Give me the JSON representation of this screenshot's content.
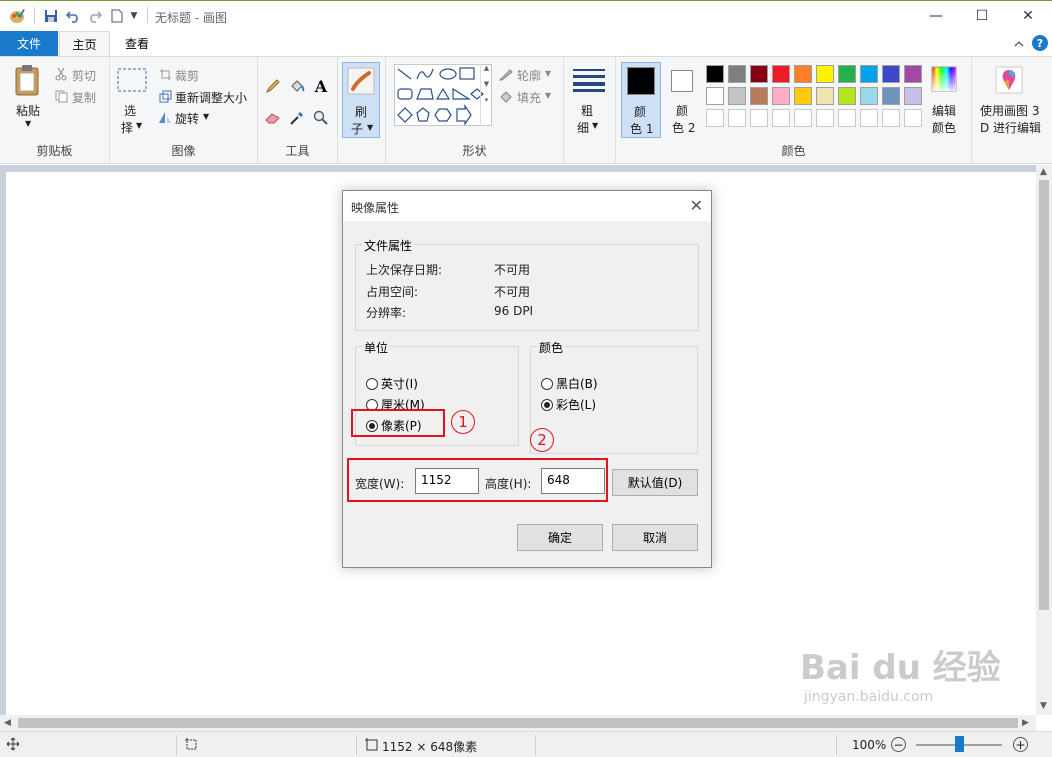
{
  "window": {
    "title": "无标题 - 画图",
    "minimize": "—",
    "maximize": "☐",
    "close": "✕"
  },
  "tabs": {
    "file": "文件",
    "home": "主页",
    "view": "查看"
  },
  "ribbon": {
    "clipboard": {
      "label": "剪贴板",
      "paste": "粘贴",
      "cut": "剪切",
      "copy": "复制"
    },
    "image": {
      "label": "图像",
      "select": "选",
      "select2": "择",
      "crop": "裁剪",
      "resize": "重新调整大小",
      "rotate": "旋转"
    },
    "tools": {
      "label": "工具",
      "text_tool": "A"
    },
    "brushes": {
      "label1": "刷",
      "label2": "子"
    },
    "shapes": {
      "label": "形状",
      "outline": "轮廓",
      "fill": "填充"
    },
    "size": {
      "label1": "粗",
      "label2": "细"
    },
    "colors": {
      "label": "颜色",
      "color1_a": "颜",
      "color1_b": "色 1",
      "color2_a": "颜",
      "color2_b": "色 2",
      "edit_a": "编辑",
      "edit_b": "颜色",
      "palette_row1": [
        "#000000",
        "#7f7f7f",
        "#880015",
        "#ed1c24",
        "#ff7f27",
        "#fff200",
        "#22b14c",
        "#00a2e8",
        "#3f48cc",
        "#a349a4"
      ],
      "palette_row2": [
        "#ffffff",
        "#c3c3c3",
        "#b97a57",
        "#ffaec9",
        "#ffc90e",
        "#efe4b0",
        "#b5e61d",
        "#99d9ea",
        "#7092be",
        "#c8bfe7"
      ]
    },
    "paint3d": {
      "label1": "使用画图 3",
      "label2": "D 进行编辑"
    }
  },
  "dialog": {
    "title": "映像属性",
    "file_props": {
      "legend": "文件属性",
      "last_saved_label": "上次保存日期:",
      "last_saved_value": "不可用",
      "size_label": "占用空间:",
      "size_value": "不可用",
      "resolution_label": "分辨率:",
      "resolution_value": "96 DPI"
    },
    "units": {
      "legend": "单位",
      "inches": "英寸(I)",
      "cm": "厘米(M)",
      "pixels": "像素(P)",
      "selected": "pixels"
    },
    "colors": {
      "legend": "颜色",
      "bw": "黑白(B)",
      "color": "彩色(L)",
      "selected": "color"
    },
    "width_label": "宽度(W):",
    "width_value": "1152",
    "height_label": "高度(H):",
    "height_value": "648",
    "default_button": "默认值(D)",
    "ok_button": "确定",
    "cancel_button": "取消"
  },
  "annotations": {
    "mark1": "1",
    "mark2": "2"
  },
  "statusbar": {
    "dimensions": "1152 × 648像素",
    "zoom": "100%"
  },
  "watermark": {
    "line1": "Bai du 经验",
    "line2": "jingyan.baidu.com"
  }
}
